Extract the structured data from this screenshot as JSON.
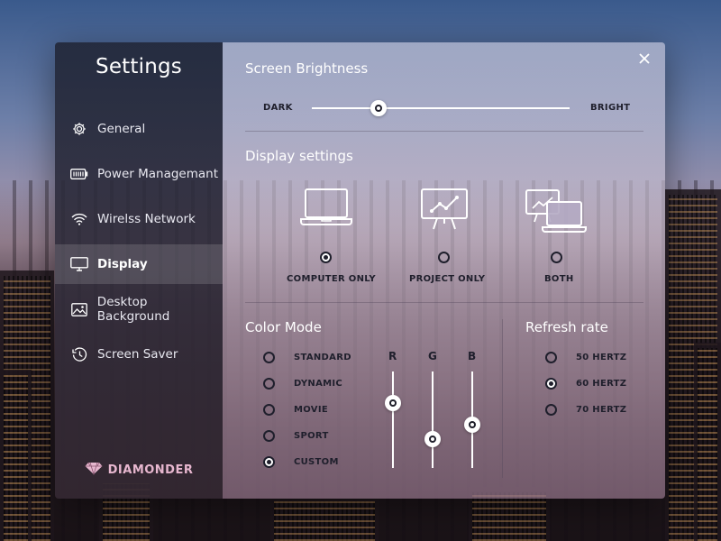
{
  "sidebar": {
    "title": "Settings",
    "items": [
      {
        "label": "General",
        "icon": "gear-icon"
      },
      {
        "label": "Power Managemant",
        "icon": "battery-icon"
      },
      {
        "label": "Wirelss Network",
        "icon": "wifi-icon"
      },
      {
        "label": "Display",
        "icon": "monitor-icon",
        "active": true
      },
      {
        "label": "Desktop Background",
        "icon": "image-icon"
      },
      {
        "label": "Screen Saver",
        "icon": "clock-icon"
      }
    ],
    "brand": "DIAMONDER"
  },
  "brightness": {
    "title": "Screen Brightness",
    "min_label": "DARK",
    "max_label": "BRIGHT",
    "value": 0.26
  },
  "display_settings": {
    "title": "Display settings",
    "options": [
      {
        "label": "COMPUTER ONLY",
        "icon": "laptop-icon",
        "selected": true
      },
      {
        "label": "PROJECT ONLY",
        "icon": "projector-icon",
        "selected": false
      },
      {
        "label": "BOTH",
        "icon": "dual-display-icon",
        "selected": false
      }
    ]
  },
  "color_mode": {
    "title": "Color Mode",
    "options": [
      {
        "label": "STANDARD",
        "selected": false
      },
      {
        "label": "DYNAMIC",
        "selected": false
      },
      {
        "label": "MOVIE",
        "selected": false
      },
      {
        "label": "SPORT",
        "selected": false
      },
      {
        "label": "CUSTOM",
        "selected": true
      }
    ],
    "channels": [
      {
        "label": "R",
        "value": 0.67
      },
      {
        "label": "G",
        "value": 0.3
      },
      {
        "label": "B",
        "value": 0.45
      }
    ]
  },
  "refresh_rate": {
    "title": "Refresh rate",
    "options": [
      {
        "label": "50 HERTZ",
        "selected": false
      },
      {
        "label": "60 HERTZ",
        "selected": true
      },
      {
        "label": "70 HERTZ",
        "selected": false
      }
    ]
  },
  "colors": {
    "brand": "#e7b7cf",
    "accent_dark": "#1e1e2a"
  }
}
